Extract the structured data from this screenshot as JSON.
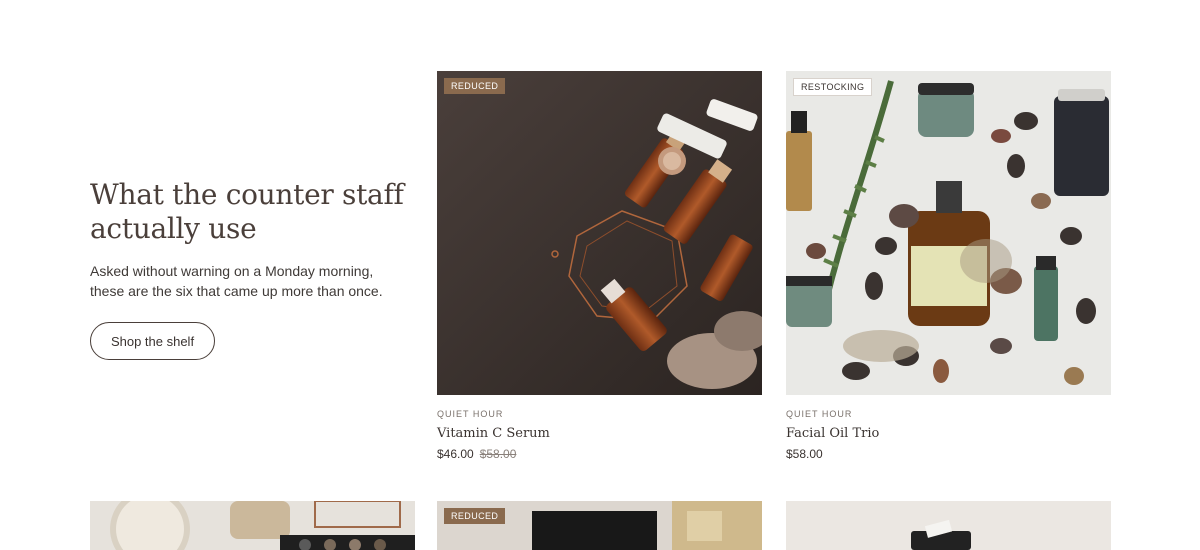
{
  "intro": {
    "heading": "What the counter staff actually use",
    "body": "Asked without warning on a Monday morning, these are the six that came up more than once.",
    "cta": "Shop the shelf"
  },
  "products": [
    {
      "badge": "REDUCED",
      "vendor": "QUIET HOUR",
      "title": "Vitamin C Serum",
      "price": "$46.00",
      "compare_price": "$58.00"
    },
    {
      "badge": "RESTOCKING",
      "vendor": "QUIET HOUR",
      "title": "Facial Oil Trio",
      "price": "$58.00"
    }
  ],
  "bottom_row": [
    {
      "badge": ""
    },
    {
      "badge": "REDUCED"
    },
    {
      "badge": ""
    }
  ],
  "colors": {
    "badge_reduced": "#8a6a4e",
    "text": "#3a3330"
  }
}
